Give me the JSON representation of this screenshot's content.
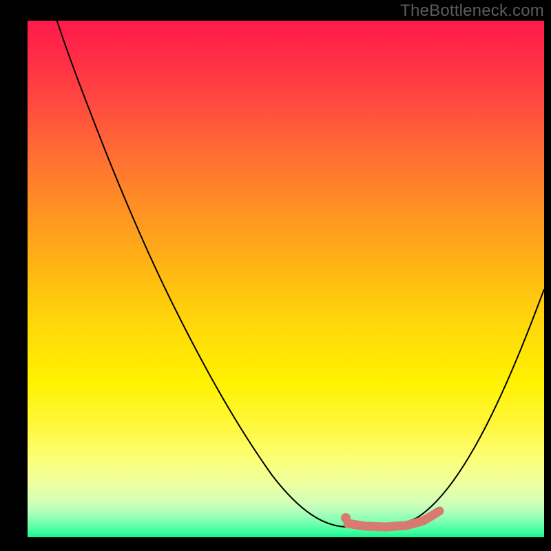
{
  "watermark": "TheBottleneck.com",
  "colors": {
    "frame": "#000000",
    "curve": "#000000",
    "highlight": "#d87a6f",
    "gradient_top": "#ff1a4a",
    "gradient_mid": "#fff200",
    "gradient_bottom": "#18f290"
  },
  "chart_data": {
    "type": "line",
    "title": "",
    "xlabel": "",
    "ylabel": "",
    "xlim": [
      0,
      100
    ],
    "ylim": [
      0,
      100
    ],
    "grid": false,
    "legend": false,
    "series": [
      {
        "name": "bottleneck-curve",
        "x": [
          0,
          6,
          12,
          18,
          24,
          30,
          36,
          42,
          48,
          54,
          58,
          62,
          66,
          70,
          74,
          78,
          82,
          86,
          90,
          94,
          98,
          100
        ],
        "y": [
          120,
          104,
          90,
          77,
          65,
          54,
          44,
          35,
          27,
          19,
          13,
          8,
          4,
          2,
          2,
          3,
          8,
          16,
          26,
          38,
          52,
          60
        ]
      },
      {
        "name": "optimal-segment",
        "x": [
          62,
          66,
          70,
          74,
          77,
          80
        ],
        "y": [
          4,
          3,
          2.5,
          2.6,
          3.2,
          5
        ]
      }
    ],
    "annotations": [
      {
        "name": "optimal-dot",
        "x": 62,
        "y": 4
      }
    ],
    "notes": "No axis ticks or labels are visible. X mapped 0–100 left→right across the gradient panel; Y mapped 0 at bottom to 100 at top; values >100 on the left indicate the curve extends above the visible frame. Values estimated from pixel positions."
  }
}
